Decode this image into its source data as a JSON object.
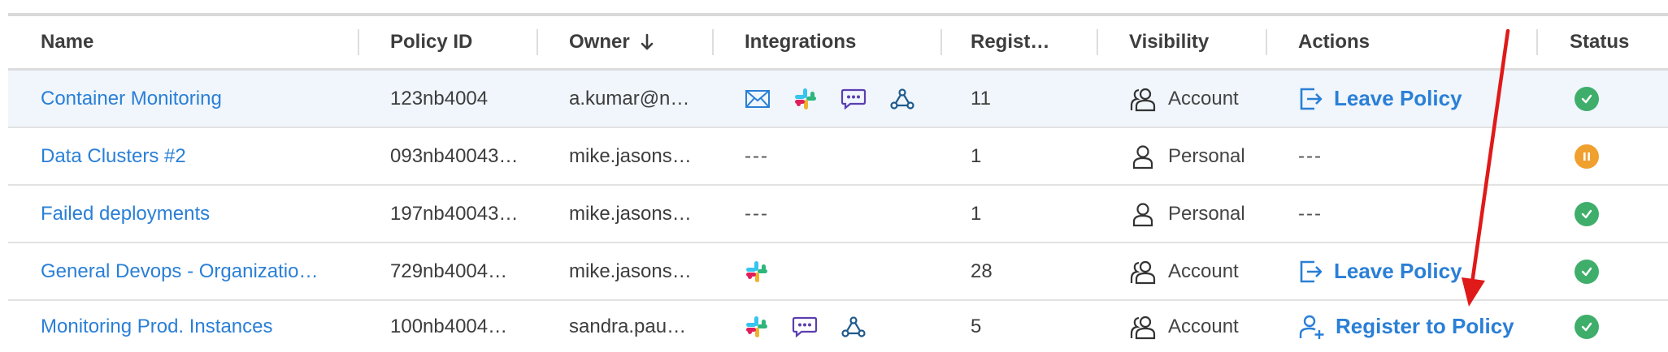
{
  "columns": {
    "name": "Name",
    "policy_id": "Policy ID",
    "owner": "Owner",
    "integrations": "Integrations",
    "registered": "Regist…",
    "visibility": "Visibility",
    "actions": "Actions",
    "status": "Status"
  },
  "sort": {
    "column": "owner",
    "direction": "descending",
    "icon": "arrow-down-icon"
  },
  "rows": [
    {
      "name": "Container Monitoring",
      "policy_id": "123nb4004",
      "owner": "a.kumar@n…",
      "integrations": [
        "email-icon",
        "slack-icon",
        "chat-icon",
        "webhook-icon"
      ],
      "registered": "11",
      "visibility": "Account",
      "visibility_icon": "group-icon",
      "action": "Leave Policy",
      "action_icon": "leave-icon",
      "status": "ok",
      "highlighted": true
    },
    {
      "name": "Data Clusters #2",
      "policy_id": "093nb40043…",
      "owner": "mike.jasons…",
      "integrations_text": "---",
      "registered": "1",
      "visibility": "Personal",
      "visibility_icon": "person-icon",
      "action_text": "---",
      "status": "paused"
    },
    {
      "name": "Failed deployments",
      "policy_id": "197nb40043…",
      "owner": "mike.jasons…",
      "integrations_text": "---",
      "registered": "1",
      "visibility": "Personal",
      "visibility_icon": "person-icon",
      "action_text": "---",
      "status": "ok"
    },
    {
      "name": "General Devops - Organizatio…",
      "policy_id": "729nb4004…",
      "owner": "mike.jasons…",
      "integrations": [
        "slack-icon"
      ],
      "registered": "28",
      "visibility": "Account",
      "visibility_icon": "group-icon",
      "action": "Leave Policy",
      "action_icon": "leave-icon",
      "status": "ok"
    },
    {
      "name": "Monitoring Prod. Instances",
      "policy_id": "100nb4004…",
      "owner": "sandra.pau…",
      "integrations": [
        "slack-icon",
        "chat-icon",
        "webhook-icon"
      ],
      "registered": "5",
      "visibility": "Account",
      "visibility_icon": "group-icon",
      "action": "Register to Policy",
      "action_icon": "user-plus-icon",
      "status": "ok"
    }
  ],
  "colors": {
    "link": "#2a7fd6",
    "status_ok": "#3fae6b",
    "status_paused": "#f0a02f",
    "annotation_arrow": "#e01919"
  },
  "annotation": {
    "type": "arrow",
    "color": "#e01919",
    "points_to": "register-to-policy"
  }
}
